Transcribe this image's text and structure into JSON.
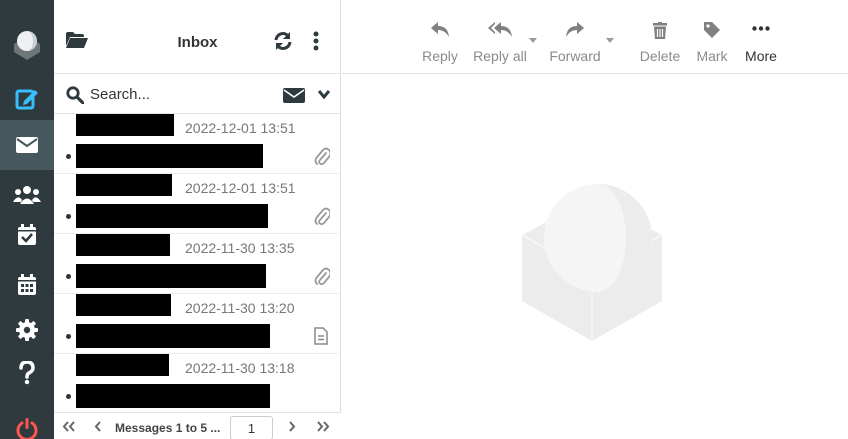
{
  "rail": {
    "items": [
      {
        "name": "logo",
        "icon": "roundcube-logo-icon"
      },
      {
        "name": "compose",
        "icon": "compose-icon",
        "color": "#37beff"
      },
      {
        "name": "mail",
        "icon": "envelope-icon",
        "active": true
      },
      {
        "name": "contacts",
        "icon": "contacts-icon"
      },
      {
        "name": "tasks",
        "icon": "tasks-icon"
      },
      {
        "name": "calendar",
        "icon": "calendar-icon"
      },
      {
        "name": "settings",
        "icon": "gear-icon"
      },
      {
        "name": "help",
        "icon": "help-icon"
      },
      {
        "name": "logout",
        "icon": "power-icon",
        "color": "#ff5552"
      }
    ]
  },
  "list": {
    "folder_title": "Inbox",
    "search_placeholder": "Search...",
    "messages": [
      {
        "date": "2022-12-01 13:51",
        "attachment": "paperclip-icon"
      },
      {
        "date": "2022-12-01 13:51",
        "attachment": "paperclip-icon"
      },
      {
        "date": "2022-11-30 13:35",
        "attachment": "paperclip-icon"
      },
      {
        "date": "2022-11-30 13:20",
        "attachment": "document-icon"
      },
      {
        "date": "2022-11-30 13:18",
        "attachment": ""
      }
    ],
    "pager": {
      "text": "Messages 1 to 5 ...",
      "page": "1"
    }
  },
  "toolbar": {
    "reply": "Reply",
    "reply_all": "Reply all",
    "forward": "Forward",
    "delete": "Delete",
    "mark": "Mark",
    "more": "More"
  },
  "colors": {
    "rail_bg": "#2f3a3f",
    "rail_active": "#47575e",
    "accent": "#37beff",
    "logout": "#ff5552"
  }
}
